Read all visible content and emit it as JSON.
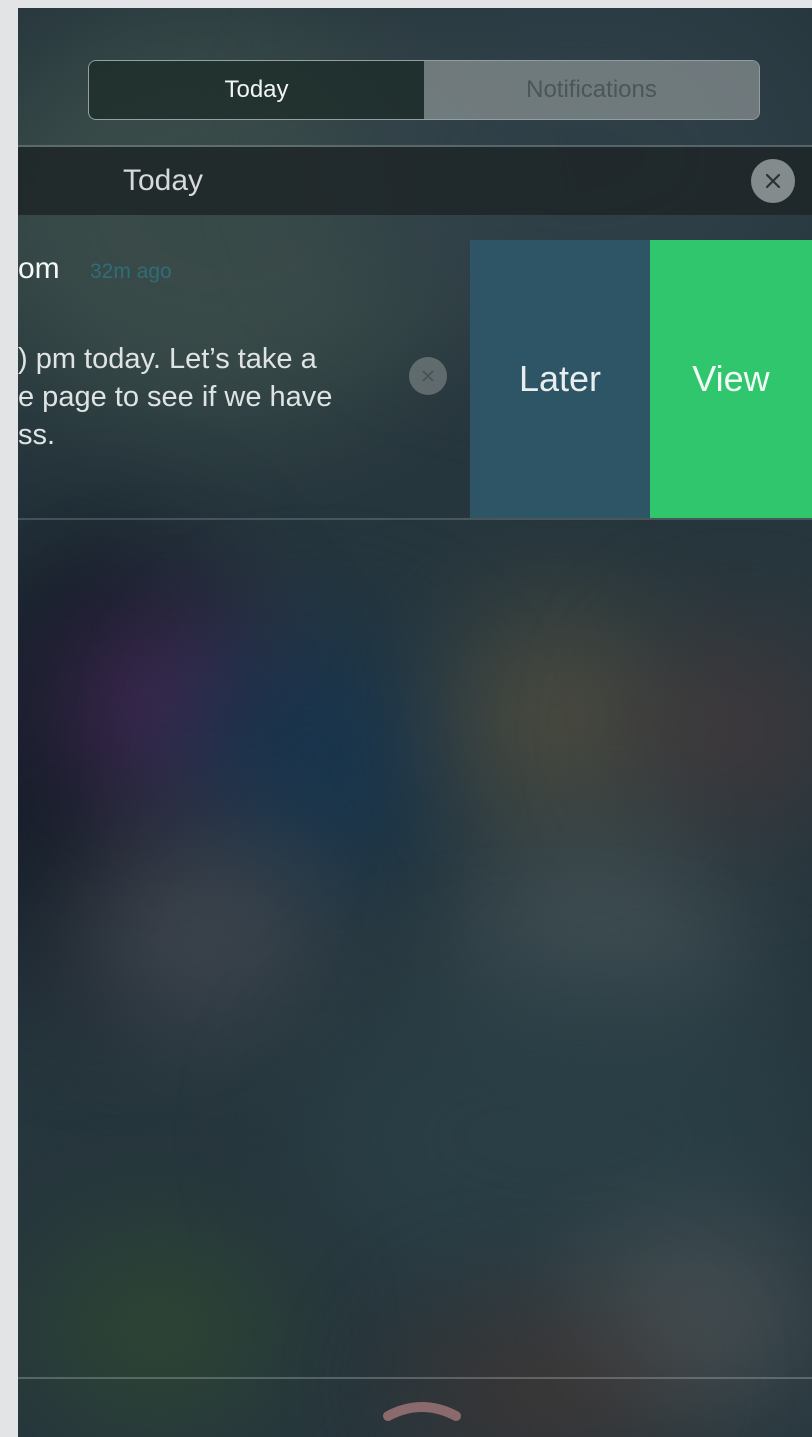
{
  "segmented": {
    "tabs": [
      {
        "label": "Today",
        "selected": true
      },
      {
        "label": "Notifications",
        "selected": false
      }
    ]
  },
  "section": {
    "title": "Today",
    "clear_icon": "close-icon"
  },
  "notification": {
    "app": "om",
    "time": "32m ago",
    "body_lines": [
      ") pm today. Let’s take a",
      "e page to see if we have",
      "ss."
    ],
    "dismiss_icon": "close-icon",
    "actions": {
      "later": "Later",
      "view": "View"
    }
  },
  "bottom": {
    "grabber_icon": "chevron-up-icon"
  },
  "colors": {
    "view_action": "#2fc66e",
    "later_action": "#2e5565",
    "time_text": "#2f6d79"
  }
}
